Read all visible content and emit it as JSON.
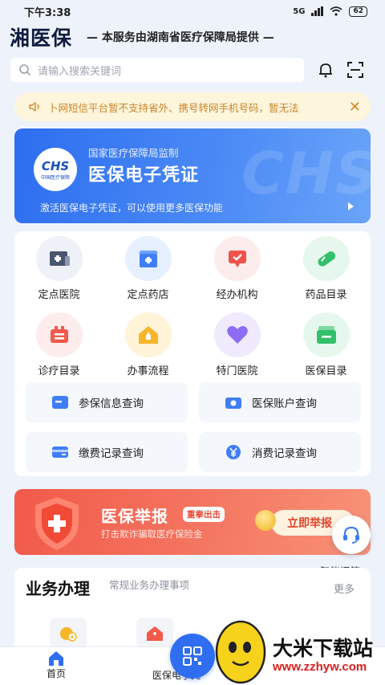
{
  "status_bar": {
    "time": "下午3:38",
    "network": "5G",
    "battery": "62"
  },
  "header": {
    "title": "湘医保",
    "subtitle": "— 本服务由湖南省医疗保障局提供 —"
  },
  "search": {
    "placeholder": "请输入搜索关键词",
    "icon": "search-icon"
  },
  "header_actions": {
    "notification_icon": "bell-icon",
    "scan_icon": "scan-icon"
  },
  "notice": {
    "icon": "speaker-icon",
    "text": "卜网短信平台暂不支持省外、携号转网手机号码，暂无法",
    "close_icon": "close-icon"
  },
  "e_card": {
    "logo_text": "CHS",
    "logo_caption": "中国医疗保障",
    "supervision": "国家医疗保障局监制",
    "title": "医保电子凭证",
    "description": "激活医保电子凭证，可以使用更多医保功能",
    "watermark": "CHS",
    "arrow_icon": "triangle-right-icon"
  },
  "services": {
    "grid": [
      {
        "label": "定点医院",
        "icon": "hospital-icon",
        "color": "#4a5670",
        "bg": "#eef1f8"
      },
      {
        "label": "定点药店",
        "icon": "pharmacy-icon",
        "color": "#3f7ef5",
        "bg": "#e7f0fe"
      },
      {
        "label": "经办机构",
        "icon": "agency-icon",
        "color": "#f0524a",
        "bg": "#fdecec"
      },
      {
        "label": "药品目录",
        "icon": "pill-icon",
        "color": "#33c06a",
        "bg": "#e6f8ee"
      },
      {
        "label": "诊疗目录",
        "icon": "kit-icon",
        "color": "#f25a4a",
        "bg": "#fdecec"
      },
      {
        "label": "办事流程",
        "icon": "house-icon",
        "color": "#f7b52a",
        "bg": "#fff4d8"
      },
      {
        "label": "特门医院",
        "icon": "heart-icon",
        "color": "#8e6cf3",
        "bg": "#efeafe"
      },
      {
        "label": "医保目录",
        "icon": "wallet-icon",
        "color": "#33c06a",
        "bg": "#e6f8ee"
      }
    ],
    "quick": [
      {
        "label": "参保信息查询",
        "icon": "id-card-icon"
      },
      {
        "label": "医保账户查询",
        "icon": "account-icon"
      },
      {
        "label": "缴费记录查询",
        "icon": "payment-icon"
      },
      {
        "label": "消费记录查询",
        "icon": "yuan-icon"
      }
    ]
  },
  "banner": {
    "title": "医保举报",
    "tag": "重拳出击",
    "subtitle": "打击欺诈骗取医疗保险金",
    "button": "立即举报",
    "icon": "shield-cross-icon"
  },
  "assistant": {
    "label": "智能问答",
    "icon": "headset-icon"
  },
  "business": {
    "title": "业务办理",
    "subtitle": "常规业务办理事项",
    "more": "更多"
  },
  "tabbar": {
    "home": "首页",
    "e_card": "医保电子凭",
    "home_icon": "home-icon",
    "qr_icon": "qr-code-icon"
  },
  "watermark": {
    "title": "大米下载站",
    "url": "www.zzhyw.com"
  },
  "colors": {
    "primary": "#2f6ef0",
    "report": "#f25a4a",
    "notice_text": "#c9852a"
  }
}
